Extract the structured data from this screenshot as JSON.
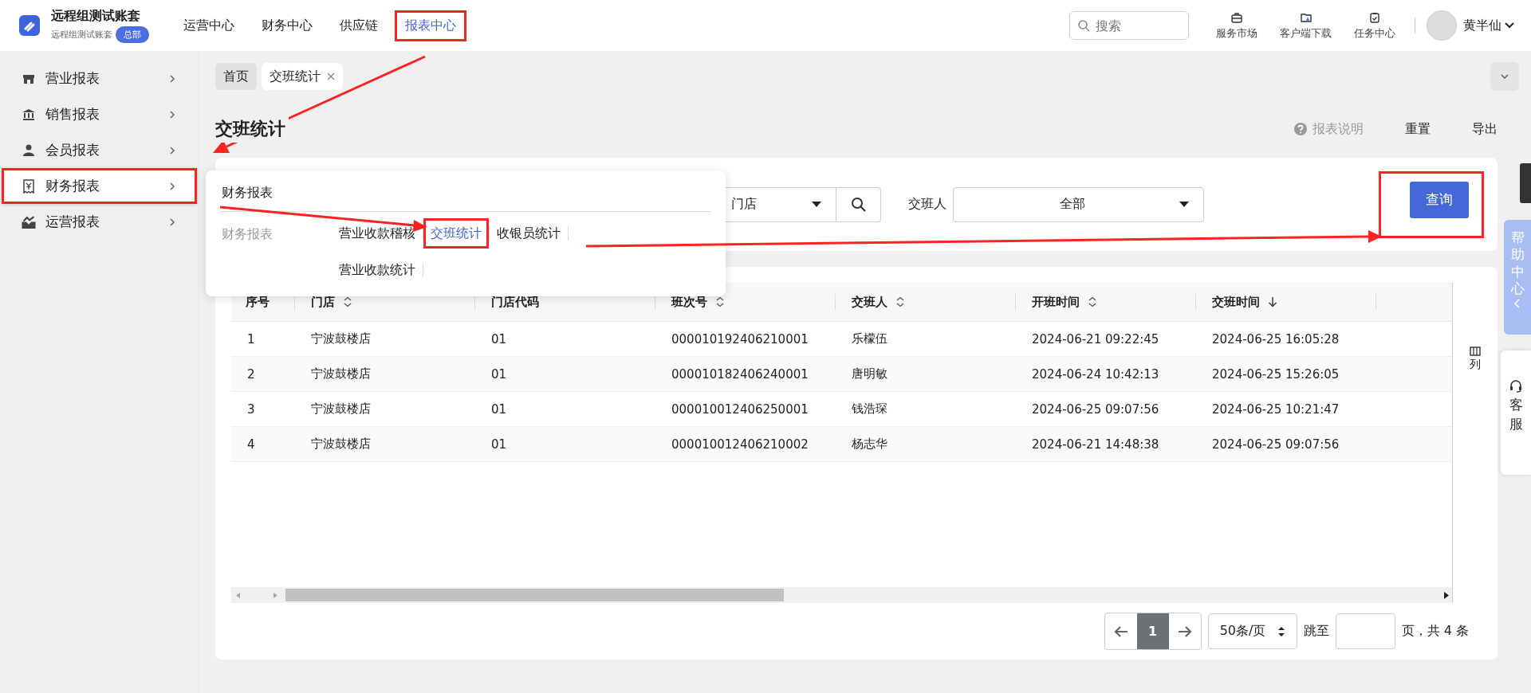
{
  "header": {
    "account_name": "远程组测试账套",
    "account_sub": "远程组测试账套",
    "badge": "总部",
    "nav": [
      {
        "label": "运营中心",
        "selected": false,
        "highlighted": false
      },
      {
        "label": "财务中心",
        "selected": false,
        "highlighted": false
      },
      {
        "label": "供应链",
        "selected": false,
        "highlighted": false
      },
      {
        "label": "报表中心",
        "selected": true,
        "highlighted": true
      }
    ],
    "search": {
      "placeholder": "搜索"
    },
    "tools": [
      {
        "label": "服务市场",
        "kind": "store"
      },
      {
        "label": "客户端下载",
        "kind": "download"
      },
      {
        "label": "任务中心",
        "kind": "task"
      }
    ],
    "user": "黄半仙"
  },
  "sidebar": {
    "items": [
      {
        "label": "营业报表",
        "kind": "store",
        "selected": false,
        "highlighted": false
      },
      {
        "label": "销售报表",
        "kind": "bank",
        "selected": false,
        "highlighted": false
      },
      {
        "label": "会员报表",
        "kind": "person",
        "selected": false,
        "highlighted": false
      },
      {
        "label": "财务报表",
        "kind": "receipt",
        "selected": true,
        "highlighted": true
      },
      {
        "label": "运营报表",
        "kind": "chart",
        "selected": false,
        "highlighted": false
      }
    ]
  },
  "tabs": [
    {
      "label": "首页",
      "selected": false,
      "closable": false
    },
    {
      "label": "交班统计",
      "selected": true,
      "closable": true
    }
  ],
  "page_title": "交班统计",
  "actions": [
    {
      "label": "报表说明",
      "kind": "help"
    },
    {
      "label": "重置",
      "kind": "plain"
    },
    {
      "label": "导出",
      "kind": "plain"
    }
  ],
  "filters": {
    "store_select": {
      "value": "门店"
    },
    "shift_person": {
      "label": "交班人",
      "value": "全部"
    },
    "query_button": {
      "label": "查询",
      "highlighted": true
    }
  },
  "popup": {
    "title": "财务报表",
    "group_label": "财务报表",
    "items": [
      {
        "label": "营业收款稽核",
        "selected": false,
        "highlighted": false
      },
      {
        "label": "交班统计",
        "selected": true,
        "highlighted": true
      },
      {
        "label": "收银员统计",
        "selected": false,
        "highlighted": false
      },
      {
        "label": "营业收款统计",
        "selected": false,
        "highlighted": false
      }
    ]
  },
  "table": {
    "columns": [
      {
        "label": "序号",
        "kind": "plain"
      },
      {
        "label": "门店",
        "kind": "sortable"
      },
      {
        "label": "门店代码",
        "kind": "plain"
      },
      {
        "label": "班次号",
        "kind": "sortable"
      },
      {
        "label": "交班人",
        "kind": "sortable"
      },
      {
        "label": "开班时间",
        "kind": "sortable"
      },
      {
        "label": "交班时间",
        "kind": "sorted"
      }
    ],
    "rows": [
      [
        "1",
        "宁波鼓楼店",
        "01",
        "000010192406210001",
        "乐檬伍",
        "2024-06-21 09:22:45",
        "2024-06-25 16:05:28"
      ],
      [
        "2",
        "宁波鼓楼店",
        "01",
        "000010182406240001",
        "唐明敏",
        "2024-06-24 10:42:13",
        "2024-06-25 15:26:05"
      ],
      [
        "3",
        "宁波鼓楼店",
        "01",
        "000010012406250001",
        "钱浩琛",
        "2024-06-25 09:07:56",
        "2024-06-25 10:21:47"
      ],
      [
        "4",
        "宁波鼓楼店",
        "01",
        "000010012406210002",
        "杨志华",
        "2024-06-21 14:48:38",
        "2024-06-25 09:07:56"
      ]
    ],
    "column_settings": "列"
  },
  "pagination": {
    "pages": [
      {
        "label": "1",
        "selected": true
      }
    ],
    "page_size": "50条/页",
    "jump_label": "跳至",
    "total": "页，共 4 条"
  },
  "side_widgets": {
    "help": "帮助中心",
    "service": "客服"
  }
}
